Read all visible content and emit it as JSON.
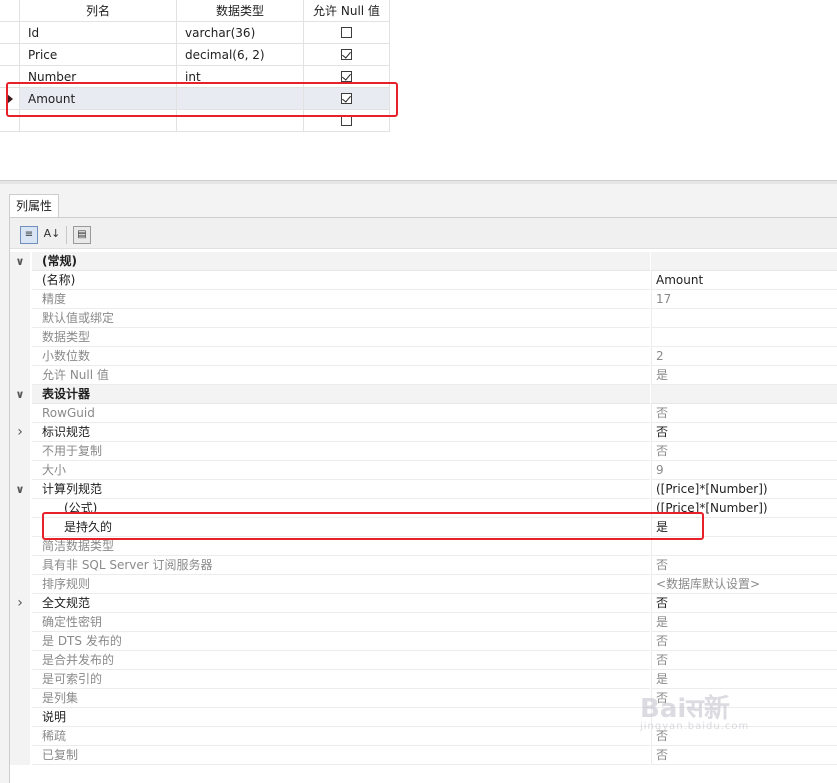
{
  "grid": {
    "headers": [
      "列名",
      "数据类型",
      "允许 Null 值"
    ],
    "rows": [
      {
        "name": "Id",
        "type": "varchar(36)",
        "nullable": false
      },
      {
        "name": "Price",
        "type": "decimal(6, 2)",
        "nullable": true
      },
      {
        "name": "Number",
        "type": "int",
        "nullable": true
      },
      {
        "name": "Amount",
        "type": "",
        "nullable": true
      }
    ]
  },
  "panel": {
    "tab_label": "列属性"
  },
  "properties": [
    {
      "kind": "category",
      "expander": "down",
      "name": "(常规)",
      "value": ""
    },
    {
      "kind": "prop",
      "name": "(名称)",
      "value": "Amount",
      "dim": false
    },
    {
      "kind": "prop",
      "name": "精度",
      "value": "17",
      "dim": true
    },
    {
      "kind": "prop",
      "name": "默认值或绑定",
      "value": "",
      "dim": true
    },
    {
      "kind": "prop",
      "name": "数据类型",
      "value": "",
      "dim": true
    },
    {
      "kind": "prop",
      "name": "小数位数",
      "value": "2",
      "dim": true
    },
    {
      "kind": "prop",
      "name": "允许 Null 值",
      "value": "是",
      "dim": true
    },
    {
      "kind": "category",
      "expander": "down",
      "name": "表设计器",
      "value": ""
    },
    {
      "kind": "prop",
      "name": "RowGuid",
      "value": "否",
      "dim": true
    },
    {
      "kind": "prop",
      "expander": "right",
      "name": "标识规范",
      "value": "否",
      "dim": false
    },
    {
      "kind": "prop",
      "name": "不用于复制",
      "value": "否",
      "dim": true
    },
    {
      "kind": "prop",
      "name": "大小",
      "value": "9",
      "dim": true
    },
    {
      "kind": "prop",
      "expander": "down",
      "name": "计算列规范",
      "value": "([Price]*[Number])",
      "dim": false
    },
    {
      "kind": "sub",
      "name": "(公式)",
      "value": "([Price]*[Number])",
      "dim": false
    },
    {
      "kind": "sub",
      "name": "是持久的",
      "value": "是",
      "dim": false
    },
    {
      "kind": "prop",
      "name": "简洁数据类型",
      "value": "",
      "dim": true
    },
    {
      "kind": "prop",
      "name": "具有非 SQL Server 订阅服务器",
      "value": "否",
      "dim": true
    },
    {
      "kind": "prop",
      "name": "排序规则",
      "value": "<数据库默认设置>",
      "dim": true
    },
    {
      "kind": "prop",
      "expander": "right",
      "name": "全文规范",
      "value": "否",
      "dim": false
    },
    {
      "kind": "prop",
      "name": "确定性密钥",
      "value": "是",
      "dim": true
    },
    {
      "kind": "prop",
      "name": "是 DTS 发布的",
      "value": "否",
      "dim": true
    },
    {
      "kind": "prop",
      "name": "是合并发布的",
      "value": "否",
      "dim": true
    },
    {
      "kind": "prop",
      "name": "是可索引的",
      "value": "是",
      "dim": true
    },
    {
      "kind": "prop",
      "name": "是列集",
      "value": "否",
      "dim": true
    },
    {
      "kind": "prop",
      "name": "说明",
      "value": "",
      "dim": false
    },
    {
      "kind": "prop",
      "name": "稀疏",
      "value": "否",
      "dim": true
    },
    {
      "kind": "prop",
      "name": "已复制",
      "value": "否",
      "dim": true
    }
  ],
  "colors": {
    "highlight": "#e8202a",
    "selected_row": "#e8ecf2",
    "dim_text": "#8a8a8a"
  }
}
